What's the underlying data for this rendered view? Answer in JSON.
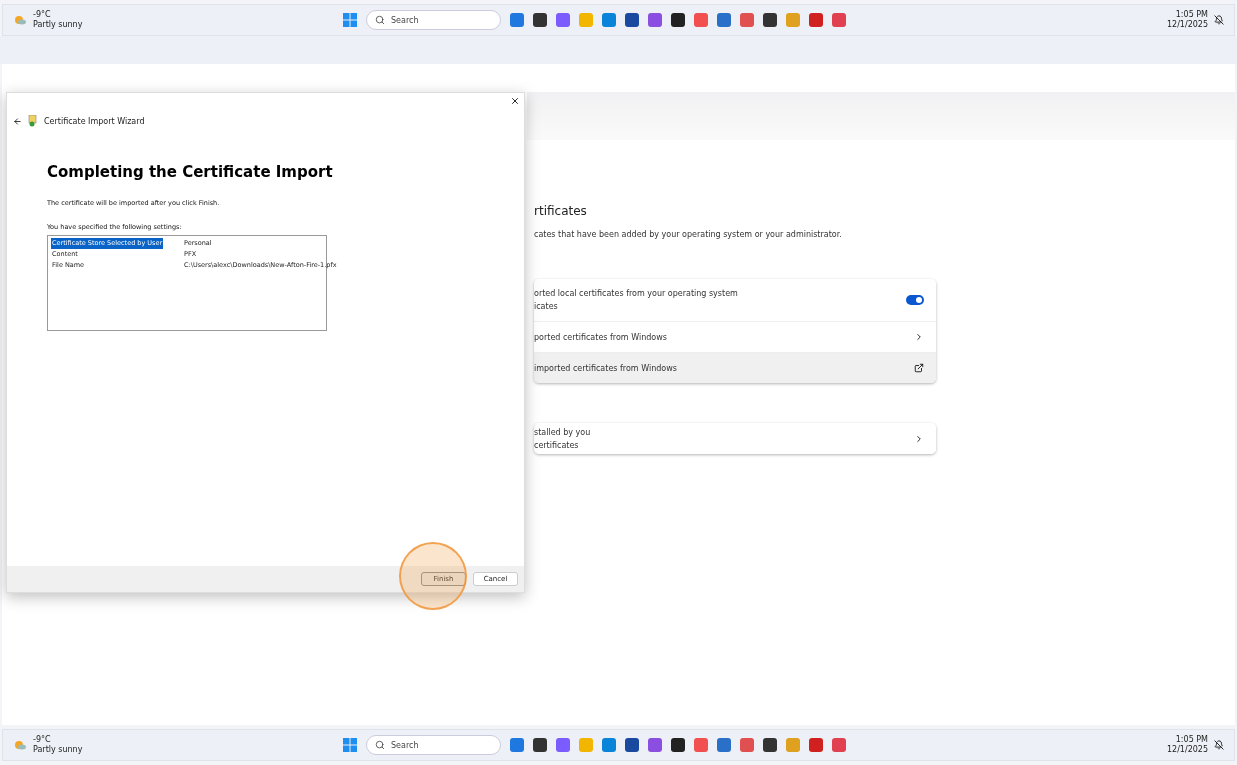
{
  "taskbars": [
    {
      "temperature": "-9°C",
      "condition": "Partly sunny",
      "search": {
        "placeholder": "Search"
      },
      "time": "1:05 PM",
      "date": "12/1/2025"
    },
    {
      "temperature": "-9°C",
      "condition": "Partly sunny",
      "search": {
        "placeholder": "Search"
      },
      "time": "1:05 PM",
      "date": "12/1/2025"
    }
  ],
  "settings": {
    "title": "rtificates",
    "description": "cates that have been added by your operating system or your administrator.",
    "groups": [
      {
        "rows": [
          {
            "kind": "toggle",
            "label": "orted local certificates from your operating system",
            "sublabel": "icates",
            "on": true
          },
          {
            "kind": "chevron",
            "label": "ported certificates from Windows"
          },
          {
            "kind": "external",
            "label": "imported certificates from Windows"
          }
        ]
      },
      {
        "rows": [
          {
            "kind": "chevron",
            "label": "stalled by you",
            "sublabel": "certificates"
          }
        ]
      }
    ]
  },
  "dialog": {
    "title": "Certificate Import Wizard",
    "heading": "Completing the Certificate Import",
    "intro": "The certificate will be imported after you click Finish.",
    "settings_label": "You have specified the following settings:",
    "settings": [
      {
        "name": "Certificate Store Selected by User",
        "value": "Personal",
        "selected": true
      },
      {
        "name": "Content",
        "value": "PFX",
        "selected": false
      },
      {
        "name": "File Name",
        "value": "C:\\Users\\alexc\\Downloads\\New-Afton-Fire-1.pfx",
        "selected": false
      }
    ],
    "buttons": [
      {
        "label": "Finish",
        "highlighted": true
      },
      {
        "label": "Cancel",
        "highlighted": false
      }
    ]
  }
}
